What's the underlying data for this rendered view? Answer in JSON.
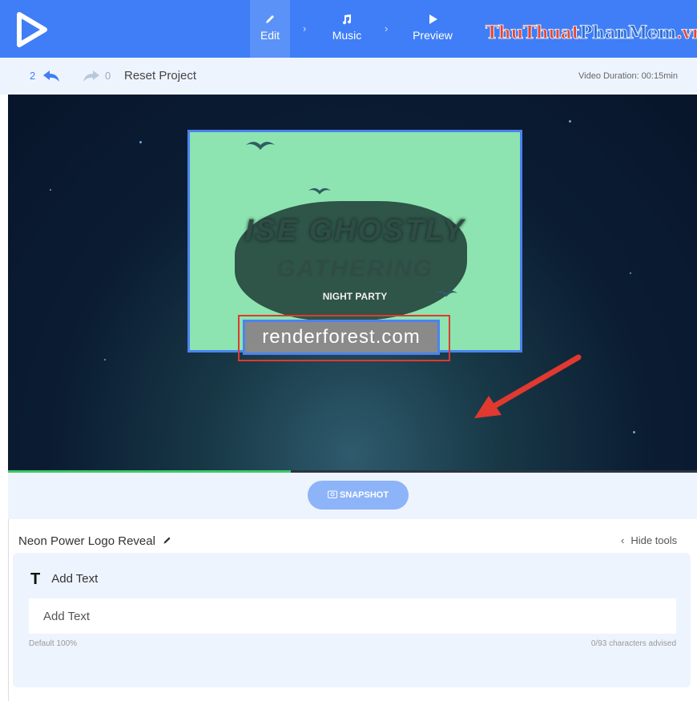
{
  "steps": [
    {
      "label": "Edit",
      "icon": "pencil-icon"
    },
    {
      "label": "Music",
      "icon": "music-note-icon"
    },
    {
      "label": "Preview",
      "icon": "play-icon"
    }
  ],
  "watermark": {
    "part1": "ThuThuat",
    "part2": "PhanMem",
    "part3": ".vn"
  },
  "subbar": {
    "undo_count": "2",
    "redo_count": "0",
    "reset_label": "Reset Project",
    "duration": "Video Duration: 00:15min"
  },
  "preview": {
    "logo_line1": "ISE GHOSTLY",
    "logo_line2": "GATHERING",
    "logo_line3": "NIGHT PARTY",
    "url_text": "renderforest.com"
  },
  "progress": {
    "value": 0.41
  },
  "snapshot": {
    "label": "SNAPSHOT"
  },
  "panel": {
    "title": "Neon Power Logo Reveal",
    "hide_tools": "Hide tools",
    "card_title": "Add Text",
    "field_value": "Add Text",
    "meta_left": "Default  100%",
    "meta_right": "0/93 characters advised"
  },
  "colors": {
    "accent": "#3f7ef6",
    "progress": "#3bc968",
    "highlight": "#e0392f"
  }
}
